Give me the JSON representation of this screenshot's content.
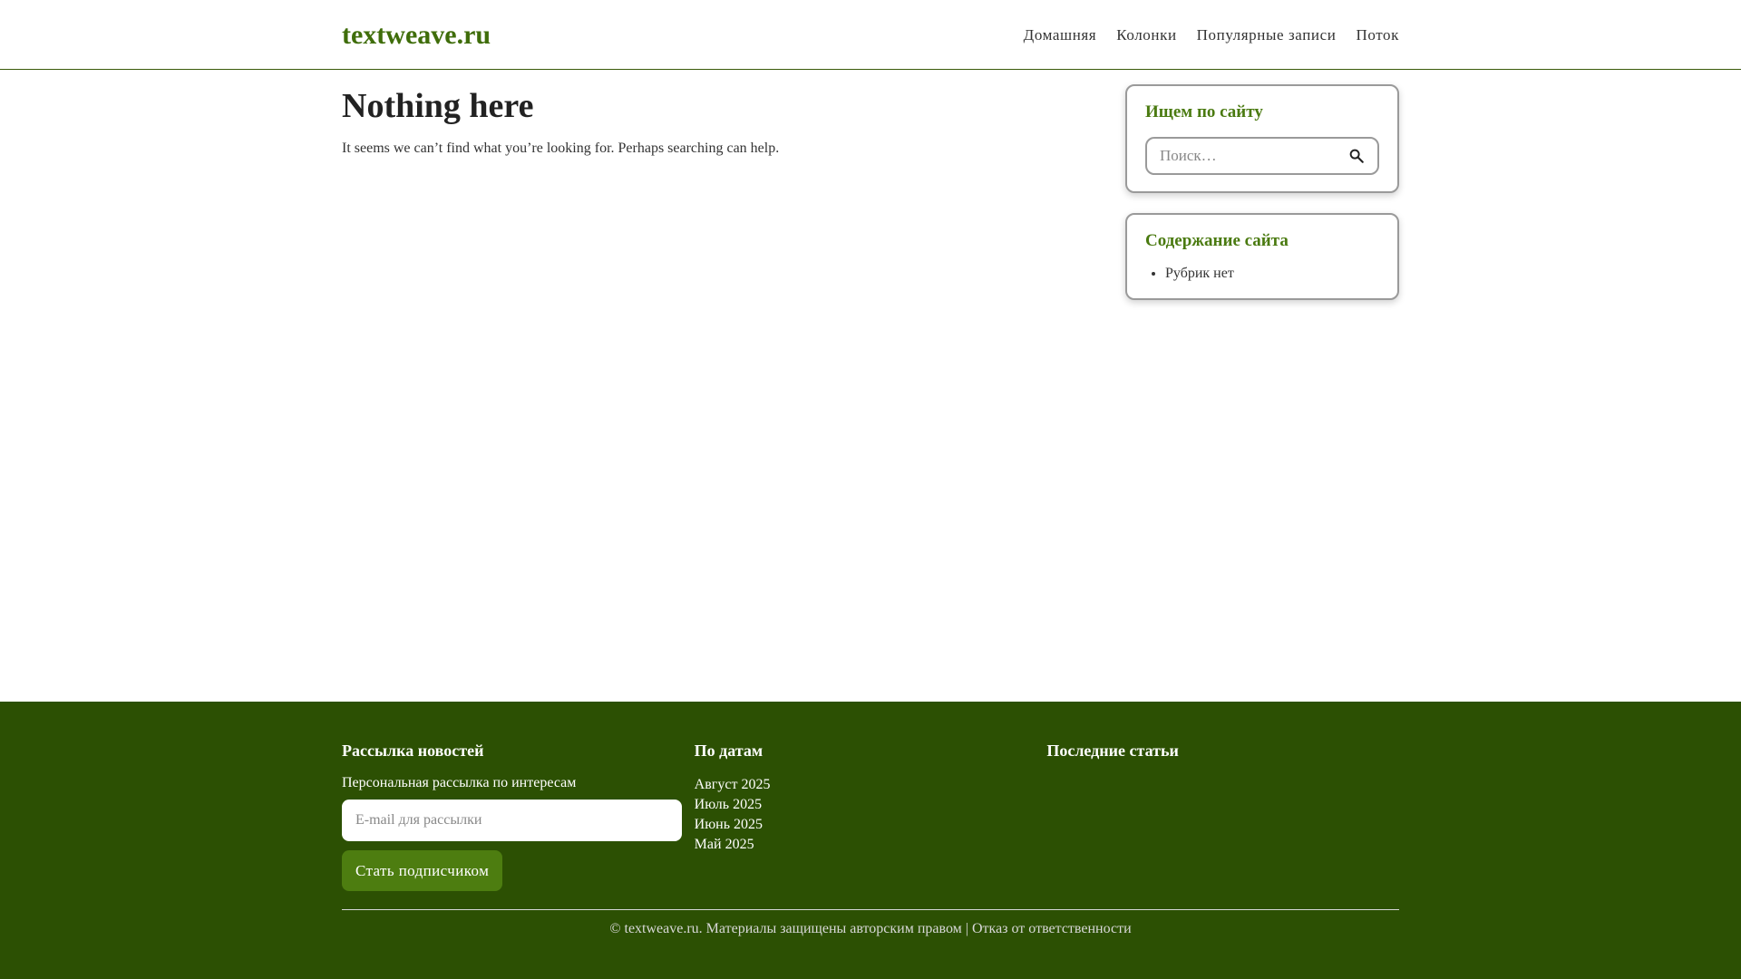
{
  "header": {
    "logo": "textweave.ru",
    "nav": [
      "Домашняя",
      "Колонки",
      "Популярные записи",
      "Поток"
    ]
  },
  "content": {
    "title": "Nothing here",
    "message": "It seems we can’t find what you’re looking for. Perhaps searching can help."
  },
  "sidebar": {
    "search_widget": {
      "title": "Ищем по сайту",
      "placeholder": "Поиск…"
    },
    "categories_widget": {
      "title": "Содержание сайта",
      "items": [
        "Рубрик нет"
      ]
    }
  },
  "footer": {
    "newsletter": {
      "title": "Рассылка новостей",
      "text": "Персональная рассылка по интересам",
      "email_placeholder": "E-mail для рассылки",
      "button_label": "Стать подписчиком"
    },
    "archive": {
      "title": "По датам",
      "items": [
        "Август 2025",
        "Июль 2025",
        "Июнь 2025",
        "Май 2025"
      ]
    },
    "recent": {
      "title": "Последние статьи"
    },
    "copyright": "© textweave.ru. Материалы защищены авторским правом",
    "separator": " | ",
    "disclaimer": "Отказ от ответственности"
  },
  "colors": {
    "accent": "#3f6d0a",
    "footer_bg": "#2c5003",
    "button_bg": "#4d7d10"
  },
  "icons": {
    "search": "search-icon"
  }
}
